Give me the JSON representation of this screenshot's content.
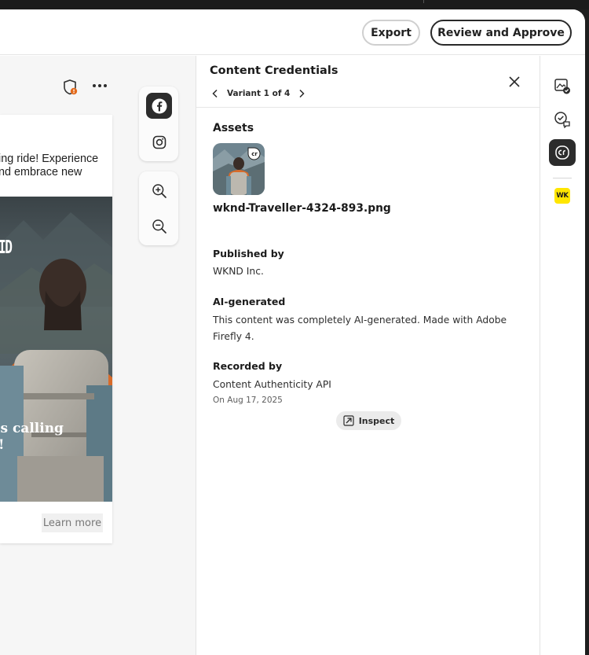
{
  "header": {
    "export_label": "Export",
    "review_label": "Review and Approve"
  },
  "canvas": {
    "post_text_line1": "ing ride! Experience",
    "post_text_line2": "nd embrace new",
    "brand_partial": "ID",
    "headline_line1": "is calling",
    "headline_line2": "!",
    "learn_more": "Learn more"
  },
  "toolbar": {
    "channels": [
      "facebook-icon",
      "instagram-icon"
    ],
    "zoom": [
      "zoom-in-icon",
      "zoom-out-icon"
    ]
  },
  "panel": {
    "title": "Content Credentials",
    "variant_label": "Variant 1 of 4",
    "assets_heading": "Assets",
    "filename": "wknd-Traveller-4324-893.png",
    "published_label": "Published by",
    "published_value": "WKND Inc.",
    "ai_label": "AI-generated",
    "ai_value": "This content was completely AI-generated. Made with Adobe Firefly 4.",
    "recorded_label": "Recorded by",
    "recorded_value": "Content Authenticity API",
    "recorded_date": "On Aug 17, 2025",
    "inspect_label": "Inspect",
    "thumb_badge": "cr"
  },
  "rail": {
    "items": [
      "image-check-icon",
      "comment-check-icon",
      "content-credentials-icon"
    ],
    "brand_badge": "WK",
    "brand_color": "#ffe600"
  },
  "colors": {
    "dark": "#2c2c2c",
    "accent_orange": "#e36a1c"
  }
}
